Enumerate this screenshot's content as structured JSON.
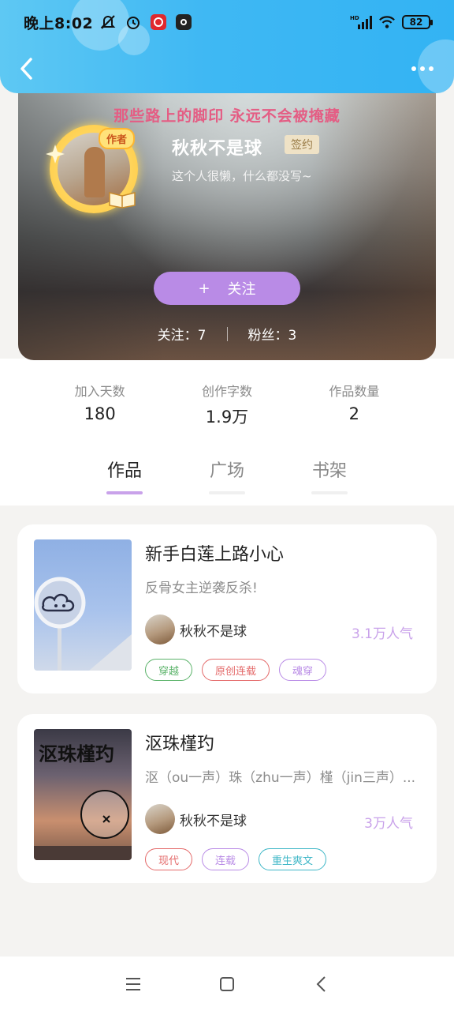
{
  "status_bar": {
    "time": "晚上8:02",
    "battery": "82",
    "icons": [
      "mute-icon",
      "alarm-icon",
      "netease-music-icon",
      "camera-app-icon",
      "hd-signal-icon",
      "wifi-icon",
      "battery-icon"
    ]
  },
  "nav": {
    "back_icon": "chevron-left-icon",
    "more_icon": "more-dots-icon"
  },
  "profile": {
    "slogan": "那些路上的脚印 永远不会被掩藏",
    "author_tag": "作者",
    "name": "秋秋不是球",
    "signed_badge": "签约",
    "bio": "这个人很懒，什么都没写~",
    "follow_button": {
      "icon": "+",
      "label": "关注"
    },
    "following": "关注：7",
    "followers": "粉丝：3"
  },
  "stats": [
    {
      "label": "加入天数",
      "value": "180"
    },
    {
      "label": "创作字数",
      "value": "1.9万"
    },
    {
      "label": "作品数量",
      "value": "2"
    }
  ],
  "tabs": [
    {
      "label": "作品",
      "active": true
    },
    {
      "label": "广场",
      "active": false
    },
    {
      "label": "书架",
      "active": false
    }
  ],
  "books": [
    {
      "title": "新手白莲上路小心",
      "desc": "反骨女主逆袭反杀!",
      "author": "秋秋不是球",
      "popularity": "3.1万人气",
      "tags": [
        {
          "label": "穿越",
          "color": "#5bb36a"
        },
        {
          "label": "原创连载",
          "color": "#e46a6a"
        },
        {
          "label": "魂穿",
          "color": "#b98be6"
        }
      ]
    },
    {
      "title": "沤珠槿玓",
      "desc": "沤（ou一声）珠（zhu一声）槿（jin三声）...",
      "author": "秋秋不是球",
      "popularity": "3万人气",
      "cover_title": "沤珠槿玓",
      "tags": [
        {
          "label": "现代",
          "color": "#e46a6a"
        },
        {
          "label": "连载",
          "color": "#b98be6"
        },
        {
          "label": "重生爽文",
          "color": "#3fb7c7"
        }
      ]
    }
  ],
  "bottom_nav": [
    "menu-icon",
    "home-square-icon",
    "back-triangle-icon"
  ],
  "colors": {
    "accent": "#b98be6",
    "slogan": "#e45d84",
    "header": "#3fb8f3"
  }
}
